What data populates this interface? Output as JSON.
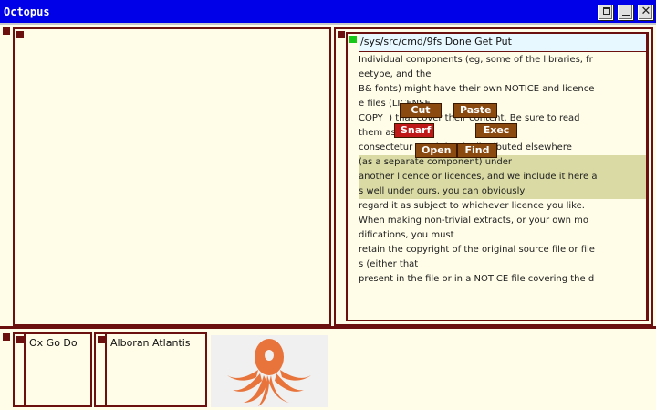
{
  "window": {
    "title": "Octopus",
    "controls": [
      "restore",
      "minimize",
      "close"
    ],
    "title_bar_color": "#0000e8"
  },
  "left_window": {
    "tag": ""
  },
  "right_window": {
    "tag": "/sys/src/cmd/9fs Done Get Put",
    "body_lines": [
      "Individual components (eg, some of the libraries, fr",
      "eetype, and the",
      "B& fonts) might have their own NOTICE and licence",
      "e files (LICENSE",
      "COPY  ) that cover their content. Be sure to read",
      "them as well.",
      "consectetur   and that is distributed elsewhere",
      "(as a separate component) under",
      "another licence or licences, and we include it here a",
      "s well under ours, you can obviously",
      "regard it as subject to whichever licence you like.",
      "",
      "When making non-trivial extracts, or your own mo",
      "difications, you must",
      "retain the copyright of the original source file or file",
      "s (either that",
      "present in the file or in a NOTICE file covering the d"
    ],
    "popup": {
      "cut": "Cut",
      "paste": "Paste",
      "snarf": "Snarf",
      "exec": "Exec",
      "open": "Open",
      "find": "Find"
    }
  },
  "bottom_row": {
    "items": [
      {
        "label": "Ox Go Do"
      },
      {
        "label": "Alboran Atlantis"
      }
    ],
    "logo": "octopus-logo"
  },
  "colors": {
    "frame": "#6b0f0f",
    "background": "#fffde8",
    "selection": "#dadba4",
    "popup_button": "#8a4a10",
    "popup_button_alt": "#c01818",
    "active_tag": "#18c818",
    "octopus": "#e8743c"
  }
}
